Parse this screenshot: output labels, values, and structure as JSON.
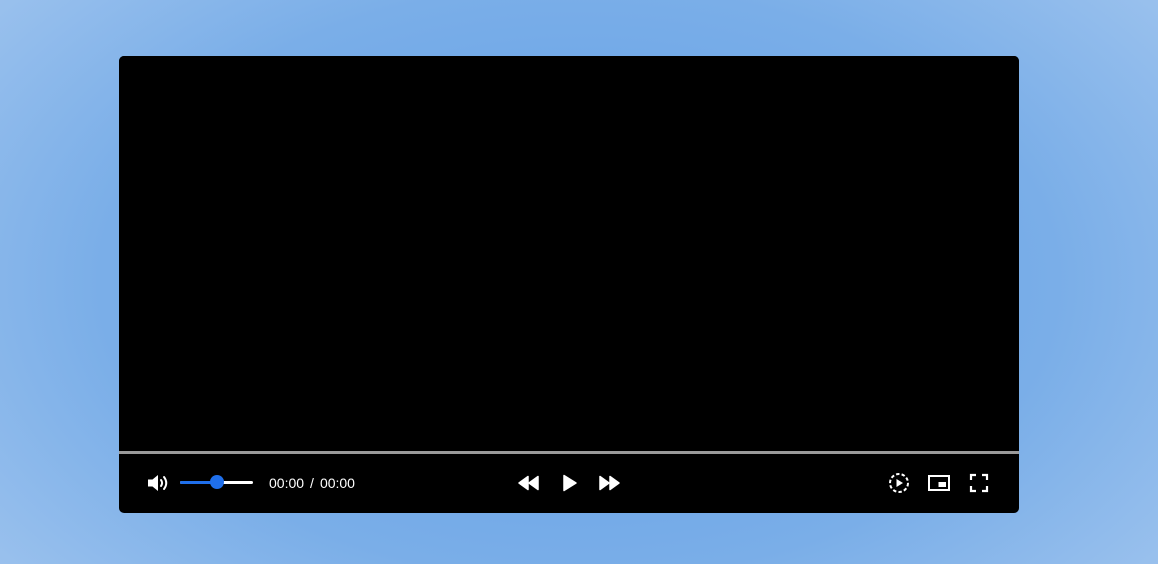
{
  "player": {
    "current_time": "00:00",
    "time_separator": "/",
    "duration": "00:00",
    "playback_progress": 0,
    "volume_level": 0.5,
    "accent_color": "#1f6feb",
    "controls": {
      "volume_icon": "volume-high-icon",
      "rewind_icon": "rewind-icon",
      "play_icon": "play-icon",
      "forward_icon": "fast-forward-icon",
      "speed_icon": "playback-speed-icon",
      "pip_icon": "picture-in-picture-icon",
      "fullscreen_icon": "fullscreen-icon"
    }
  }
}
